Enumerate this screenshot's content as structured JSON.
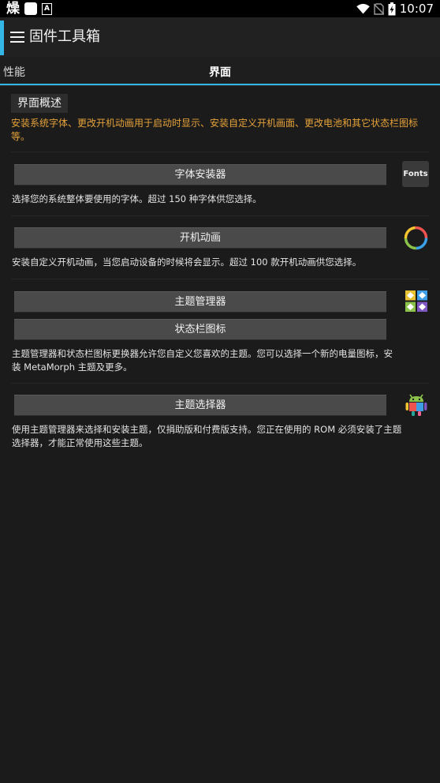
{
  "status_bar": {
    "left_char": "燥",
    "a_icon": "A",
    "time": "10:07",
    "icons": [
      "wifi-icon",
      "no-sim-icon",
      "battery-charging-icon"
    ]
  },
  "app_bar": {
    "title": "固件工具箱",
    "accent": "#33b5e5"
  },
  "tabs": [
    {
      "label": "性能",
      "active": false
    },
    {
      "label": "界面",
      "active": true
    }
  ],
  "section": {
    "header": "界面概述",
    "intro": "安装系统字体、更改开机动画用于启动时显示、安装自定义开机画面、更改电池和其它状态栏图标等。",
    "intro_color": "#e5a23a"
  },
  "items": [
    {
      "buttons": [
        "字体安装器"
      ],
      "description": "选择您的系统整体要使用的字体。超过 150 种字体供您选择。",
      "icon": "fonts-icon",
      "icon_text": "Fonts"
    },
    {
      "buttons": [
        "开机动画"
      ],
      "description": "安装自定义开机动画，当您启动设备的时候将会显示。超过 100 款开机动画供您选择。",
      "icon": "boot-animation-ring-icon"
    },
    {
      "buttons": [
        "主题管理器",
        "状态栏图标"
      ],
      "description_lines": [
        "主题管理器和状态栏图标更换器允许您自定义您喜欢的主题。您可以选择一个新的电量图标，安",
        "装 MetaMorph 主题及更多。"
      ],
      "icon": "theme-tiles-icon"
    },
    {
      "buttons": [
        "主题选择器"
      ],
      "description_lines": [
        "使用主题管理器来选择和安装主题，仅捐助版和付费版支持。您正在使用的 ROM 必须安装了主题",
        "选择器，才能正常使用这些主题。"
      ],
      "icon": "colorful-android-icon"
    }
  ]
}
